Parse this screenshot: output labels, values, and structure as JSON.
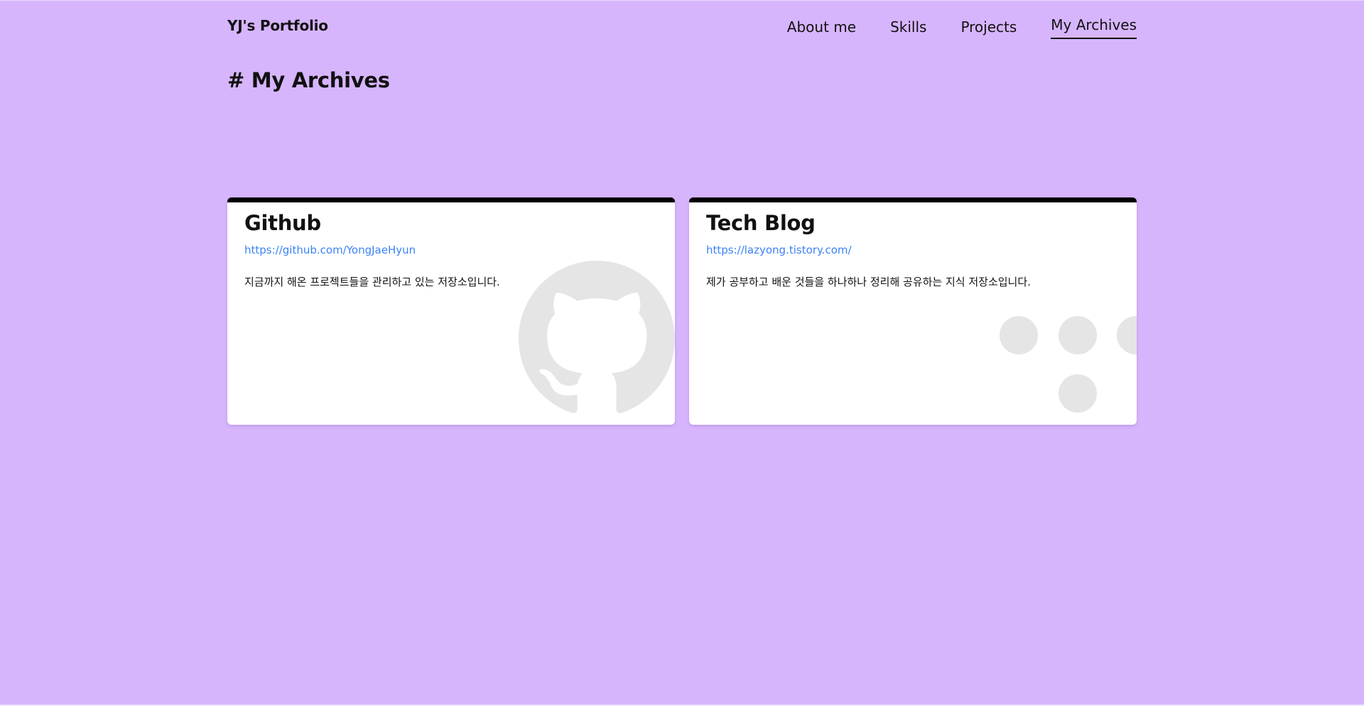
{
  "header": {
    "brand": "YJ's Portfolio",
    "nav": [
      {
        "label": "About me",
        "active": false
      },
      {
        "label": "Skills",
        "active": false
      },
      {
        "label": "Projects",
        "active": false
      },
      {
        "label": "My Archives",
        "active": true
      }
    ]
  },
  "section": {
    "title": "# My Archives"
  },
  "cards": [
    {
      "title": "Github",
      "url": "https://github.com/YongJaeHyun",
      "description": "지금까지 해온 프로젝트들을 관리하고 있는 저장소입니다.",
      "icon": "github-icon"
    },
    {
      "title": "Tech Blog",
      "url": "https://lazyong.tistory.com/",
      "description": "제가 공부하고 배운 것들을 하나하나 정리해 공유하는 지식 저장소입니다.",
      "icon": "tistory-icon"
    }
  ],
  "colors": {
    "background": "#d7b5fd",
    "card": "#ffffff",
    "card_top_border": "#000000",
    "link": "#3b82f6",
    "icon_watermark": "#e5e5e5"
  }
}
